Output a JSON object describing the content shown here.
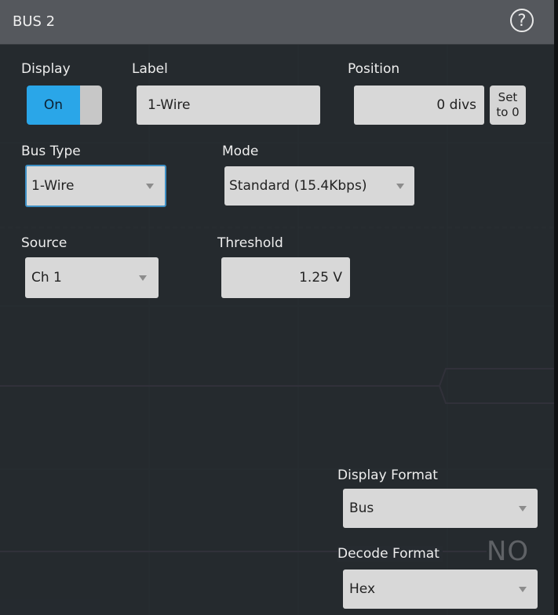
{
  "panel": {
    "title": "BUS 2"
  },
  "display": {
    "label": "Display",
    "value": "On"
  },
  "label_field": {
    "label": "Label",
    "value": "1-Wire"
  },
  "position": {
    "label": "Position",
    "value": "0 divs",
    "set_button": [
      "Set",
      "to 0"
    ]
  },
  "bus_type": {
    "label": "Bus Type",
    "value": "1-Wire"
  },
  "mode": {
    "label": "Mode",
    "value": "Standard (15.4Kbps)"
  },
  "source": {
    "label": "Source",
    "value": "Ch 1"
  },
  "threshold": {
    "label": "Threshold",
    "value": "1.25 V"
  },
  "display_format": {
    "label": "Display Format",
    "value": "Bus"
  },
  "decode_format": {
    "label": "Decode Format",
    "value": "Hex"
  },
  "background_text": "NO D",
  "colors": {
    "accent": "#2aa6e8",
    "trace": "#b56fb2",
    "titlebar": "#55585d"
  }
}
